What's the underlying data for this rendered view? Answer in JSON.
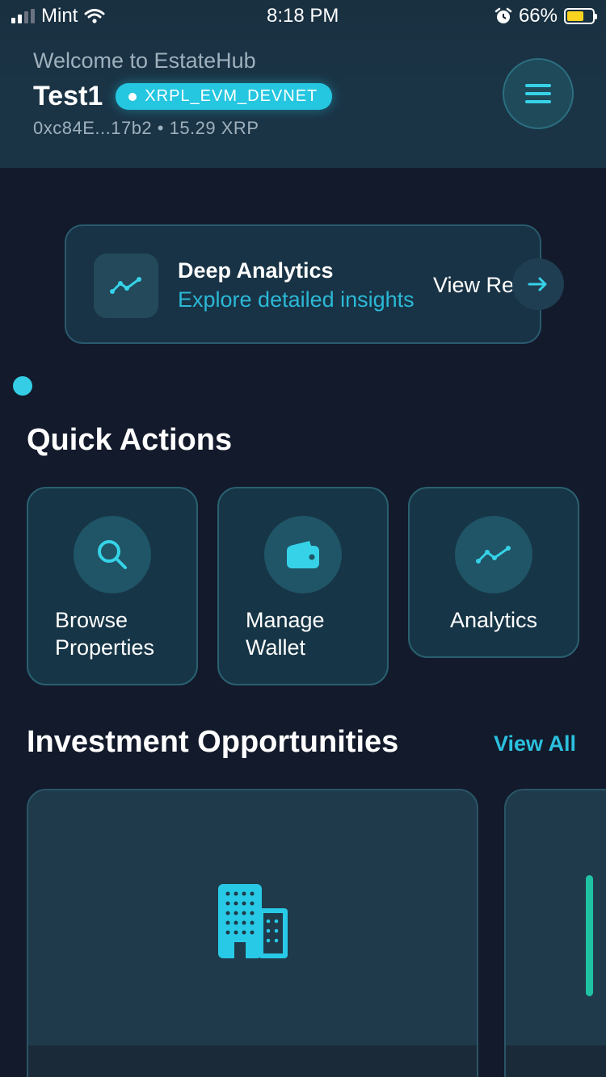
{
  "status_bar": {
    "carrier": "Mint",
    "time": "8:18 PM",
    "battery_percent": "66%"
  },
  "header": {
    "welcome": "Welcome to EstateHub",
    "user_name": "Test1",
    "network": "XRPL_EVM_DEVNET",
    "address_balance": "0xc84E...17b2 • 15.29 XRP",
    "menu_icon": "hamburger-menu-icon"
  },
  "banner": {
    "icon": "trend-line-icon",
    "title": "Deep Analytics",
    "subtitle": "Explore detailed insights",
    "link_label": "View Report",
    "arrow_icon": "arrow-right-icon"
  },
  "quick_actions": {
    "title": "Quick Actions",
    "items": [
      {
        "label_line1": "Browse",
        "label_line2": "Properties",
        "icon": "search-icon"
      },
      {
        "label_line1": "Manage",
        "label_line2": "Wallet",
        "icon": "wallet-icon"
      },
      {
        "label_line1": "Analytics",
        "label_line2": "",
        "icon": "trend-line-icon"
      }
    ]
  },
  "investments": {
    "title": "Investment Opportunities",
    "view_all": "View All",
    "card_icon": "building-icon"
  },
  "colors": {
    "background": "#121a2b",
    "accent": "#25c6e0",
    "card": "#163546"
  }
}
